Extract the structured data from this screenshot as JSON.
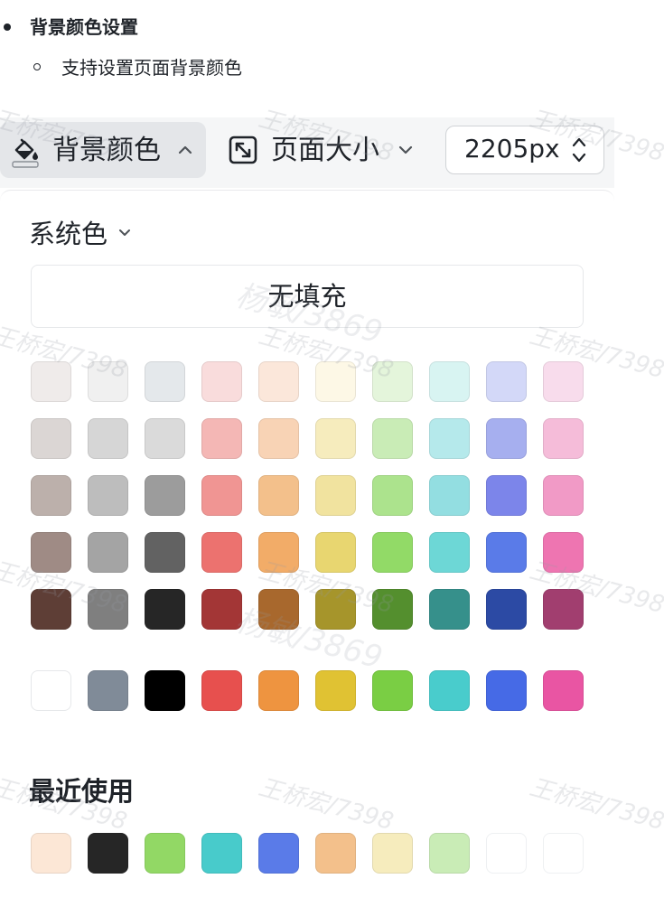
{
  "doc": {
    "heading": "背景颜色设置",
    "subitem": "支持设置页面背景颜色"
  },
  "toolbar": {
    "bg_color_label": "背景颜色",
    "page_size_label": "页面大小",
    "width_value": "2205px",
    "icons": {
      "bg_color": "paint-bucket-icon",
      "bg_color_chevron": "chevron-up-icon",
      "page_size": "resize-icon",
      "page_size_chevron": "chevron-down-icon",
      "stepper": "up-down-arrows-icon"
    }
  },
  "panel": {
    "system_colors_label": "系统色",
    "no_fill_label": "无填充",
    "recent_label": "最近使用",
    "palette": [
      [
        "#efebea",
        "#f0f0f0",
        "#e4e8eb",
        "#f9dcdc",
        "#fbe7da",
        "#fdf8e6",
        "#e4f5db",
        "#d8f4f2",
        "#d3d8f8",
        "#f8dcec"
      ],
      [
        "#dbd6d4",
        "#d6d6d6",
        "#dadada",
        "#f4b7b5",
        "#f8d3b5",
        "#f6ecbd",
        "#c9ecb6",
        "#b5e9eb",
        "#a6afef",
        "#f5bcd9"
      ],
      [
        "#bcb0ab",
        "#bdbdbd",
        "#9c9c9c",
        "#f09593",
        "#f3c08b",
        "#f1e39f",
        "#ace38d",
        "#93dee1",
        "#7c85ea",
        "#f19ac6"
      ],
      [
        "#9f8b85",
        "#a4a4a4",
        "#626262",
        "#ec726f",
        "#f2ac68",
        "#e8d670",
        "#92da67",
        "#6dd7d6",
        "#5a7be8",
        "#ee75b1"
      ],
      [
        "#5e3e36",
        "#7f7f7f",
        "#262626",
        "#a33636",
        "#a8682d",
        "#a6952b",
        "#548f2e",
        "#36908b",
        "#2c4aa4",
        "#a13e6f"
      ],
      [
        "#ffffff",
        "#808b98",
        "#000000",
        "#e7504e",
        "#ee9440",
        "#e0c233",
        "#7ace44",
        "#49cccc",
        "#466ae6",
        "#e955a3"
      ]
    ],
    "recent": [
      "#fce7d6",
      "#262626",
      "#92d865",
      "#48cbcb",
      "#5a7be8",
      "#f3c08b",
      "#f6ecbd",
      "#c9ecb6",
      "#ffffff",
      "#ffffff"
    ]
  },
  "watermarks": {
    "user_a": "王桥宏/7398",
    "user_b": "杨敏/3869"
  }
}
